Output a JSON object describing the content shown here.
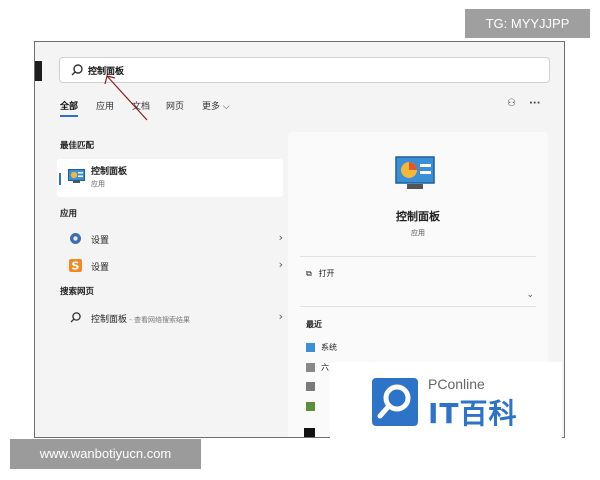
{
  "watermark_tg": "TG: MYYJJPP",
  "watermark_site": "www.wanbotiyucn.com",
  "search": {
    "value": "控制面板"
  },
  "tabs": [
    {
      "label": "全部"
    },
    {
      "label": "应用"
    },
    {
      "label": "文档"
    },
    {
      "label": "网页"
    },
    {
      "label": "更多 ⌵"
    }
  ],
  "sections": {
    "best_match": "最佳匹配",
    "apps": "应用",
    "web_search": "搜索网页"
  },
  "best_match": {
    "name": "控制面板",
    "type": "应用"
  },
  "apps": [
    {
      "label": "设置",
      "icon": "gear-icon"
    },
    {
      "label": "设置",
      "icon": "s-logo-icon"
    }
  ],
  "web": {
    "label": "控制面板",
    "sub": " - 查看网络搜索结果"
  },
  "chevron": "›",
  "preview": {
    "title": "控制面板",
    "type": "应用",
    "open_label": "打开",
    "expand": "⌄",
    "recent_label": "最近",
    "recent_items": [
      {
        "label": "系统"
      },
      {
        "label": "六"
      }
    ]
  },
  "top_icons": {
    "share": "⚇",
    "more": "···"
  },
  "logo": {
    "pconline": "PConline",
    "itbaike": "IT百科"
  },
  "colors": {
    "accent": "#2f6fd0",
    "logo_blue": "#2d73c8"
  }
}
